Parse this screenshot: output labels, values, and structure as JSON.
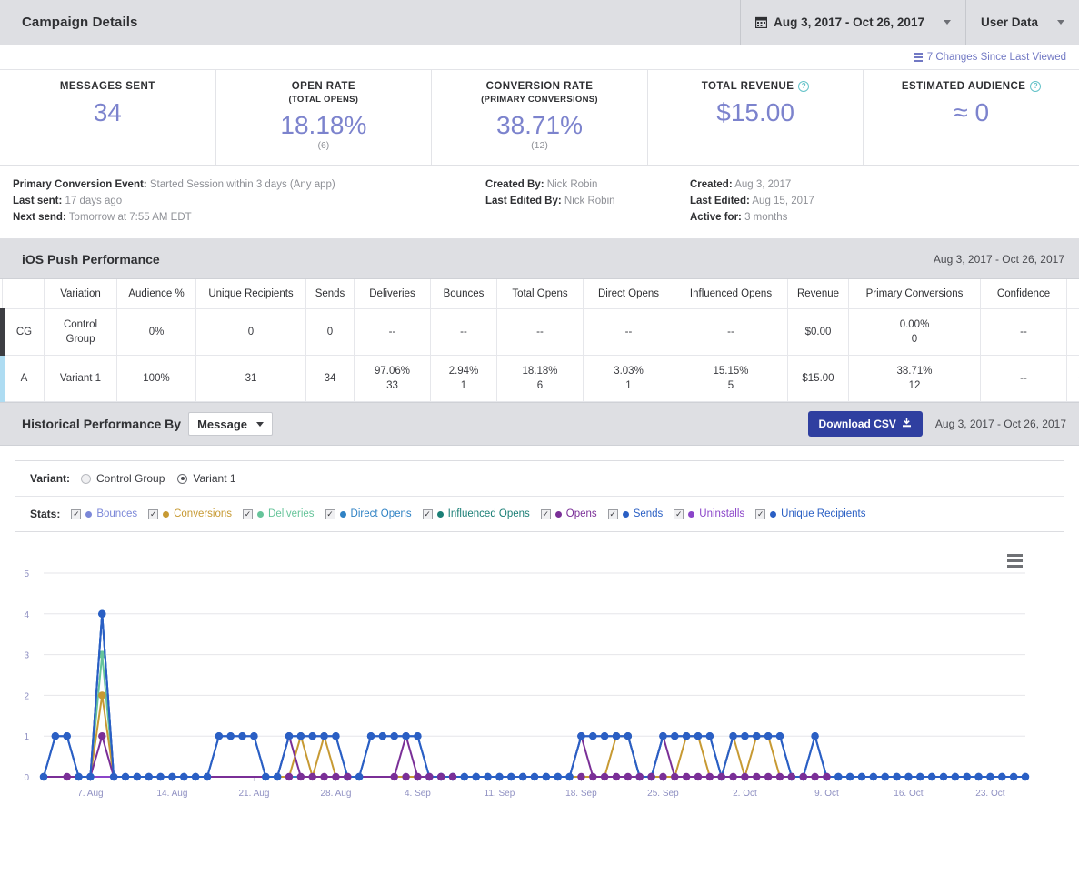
{
  "header": {
    "title": "Campaign Details",
    "date_range": "Aug 3, 2017 - Oct 26, 2017",
    "date_icon": "calendar-icon",
    "user_data_label": "User Data",
    "caret_icon": "chevron-down-icon"
  },
  "changes": {
    "label": "7 Changes Since Last Viewed",
    "icon": "list-icon"
  },
  "kpis": [
    {
      "label": "MESSAGES SENT",
      "sub": "",
      "value": "34",
      "count": "",
      "info": false
    },
    {
      "label": "OPEN RATE",
      "sub": "(TOTAL OPENS)",
      "value": "18.18%",
      "count": "(6)",
      "info": false
    },
    {
      "label": "CONVERSION RATE",
      "sub": "(PRIMARY CONVERSIONS)",
      "value": "38.71%",
      "count": "(12)",
      "info": false
    },
    {
      "label": "TOTAL REVENUE",
      "sub": "",
      "value": "$15.00",
      "count": "",
      "info": true
    },
    {
      "label": "ESTIMATED AUDIENCE",
      "sub": "",
      "value": "≈ 0",
      "count": "",
      "info": true
    }
  ],
  "meta": {
    "left": [
      {
        "label": "Primary Conversion Event:",
        "value": "Started Session within 3 days (Any app)"
      },
      {
        "label": "Last sent:",
        "value": "17 days ago"
      },
      {
        "label": "Next send:",
        "value": "Tomorrow at 7:55 AM EDT"
      }
    ],
    "middle": [
      {
        "label": "Created By:",
        "value": "Nick Robin"
      },
      {
        "label": "Last Edited By:",
        "value": "Nick Robin"
      }
    ],
    "right": [
      {
        "label": "Created:",
        "value": "Aug 3, 2017"
      },
      {
        "label": "Last Edited:",
        "value": "Aug 15, 2017"
      },
      {
        "label": "Active for:",
        "value": "3 months"
      }
    ]
  },
  "performance": {
    "title": "iOS Push Performance",
    "date_range": "Aug 3, 2017 - Oct 26, 2017",
    "columns": [
      "",
      "Variation",
      "Audience %",
      "Unique Recipients",
      "Sends",
      "Deliveries",
      "Bounces",
      "Total Opens",
      "Direct Opens",
      "Influenced Opens",
      "Revenue",
      "Primary Conversions",
      "Confidence",
      ""
    ],
    "rows": [
      {
        "tag": "CG",
        "variation": "Control Group",
        "audience": "0%",
        "unique_recipients": "0",
        "sends": "0",
        "deliveries": "--",
        "deliveries_n": "",
        "bounces": "--",
        "bounces_n": "",
        "total_opens": "--",
        "total_opens_n": "",
        "direct_opens": "--",
        "direct_opens_n": "",
        "influenced_opens": "--",
        "influenced_opens_n": "",
        "revenue": "$0.00",
        "primary_conversions": "0.00%",
        "primary_conversions_n": "0",
        "confidence": "--",
        "eye": ""
      },
      {
        "tag": "A",
        "variation": "Variant 1",
        "audience": "100%",
        "unique_recipients": "31",
        "sends": "34",
        "deliveries": "97.06%",
        "deliveries_n": "33",
        "bounces": "2.94%",
        "bounces_n": "1",
        "total_opens": "18.18%",
        "total_opens_n": "6",
        "direct_opens": "3.03%",
        "direct_opens_n": "1",
        "influenced_opens": "15.15%",
        "influenced_opens_n": "5",
        "revenue": "$15.00",
        "primary_conversions": "38.71%",
        "primary_conversions_n": "12",
        "confidence": "--",
        "eye": "◉"
      }
    ]
  },
  "historical": {
    "title": "Historical Performance By",
    "select_value": "Message",
    "download_label": "Download CSV",
    "download_icon": "download-icon",
    "date_range": "Aug 3, 2017 - Oct 26, 2017"
  },
  "filters": {
    "variant_label": "Variant:",
    "variants": [
      {
        "label": "Control Group",
        "selected": false
      },
      {
        "label": "Variant 1",
        "selected": true
      }
    ],
    "stats_label": "Stats:",
    "stats": [
      {
        "label": "Bounces",
        "color": "#7b87d8",
        "checked": true
      },
      {
        "label": "Conversions",
        "color": "#c79a33",
        "checked": true
      },
      {
        "label": "Deliveries",
        "color": "#66c49a",
        "checked": true
      },
      {
        "label": "Direct Opens",
        "color": "#2f82c4",
        "checked": true
      },
      {
        "label": "Influenced Opens",
        "color": "#1b7f76",
        "checked": true
      },
      {
        "label": "Opens",
        "color": "#7a2f97",
        "checked": true
      },
      {
        "label": "Sends",
        "color": "#2a5fc4",
        "checked": true
      },
      {
        "label": "Uninstalls",
        "color": "#8b45c9",
        "checked": true
      },
      {
        "label": "Unique Recipients",
        "color": "#2a5fc4",
        "checked": true
      }
    ]
  },
  "chart_data": {
    "type": "line",
    "title": "",
    "xlabel": "",
    "ylabel": "",
    "menu_icon": "hamburger-menu-icon",
    "ylim": [
      0,
      5
    ],
    "yticks": [
      0,
      1,
      2,
      3,
      4,
      5
    ],
    "grid": true,
    "legend": "above-chart",
    "xtick_labels": [
      "7. Aug",
      "14. Aug",
      "21. Aug",
      "28. Aug",
      "4. Sep",
      "11. Sep",
      "18. Sep",
      "25. Sep",
      "2. Oct",
      "9. Oct",
      "16. Oct",
      "23. Oct"
    ],
    "xtick_indices": [
      4,
      11,
      18,
      25,
      32,
      39,
      46,
      53,
      60,
      67,
      74,
      81
    ],
    "x_start": "3. Aug",
    "x_end": "26. Oct",
    "n_points": 85,
    "series": [
      {
        "name": "Sends",
        "color": "#2a5fc4",
        "values": [
          0,
          1,
          1,
          0,
          0,
          4,
          0,
          0,
          0,
          0,
          0,
          0,
          0,
          0,
          0,
          1,
          1,
          1,
          1,
          0,
          0,
          1,
          1,
          1,
          1,
          1,
          0,
          0,
          1,
          1,
          1,
          1,
          1,
          0,
          0,
          0,
          0,
          0,
          0,
          0,
          0,
          0,
          0,
          0,
          0,
          0,
          1,
          1,
          1,
          1,
          1,
          0,
          0,
          1,
          1,
          1,
          1,
          1,
          0,
          1,
          1,
          1,
          1,
          1,
          0,
          0,
          1,
          0,
          0,
          0,
          0,
          0,
          0,
          0,
          0,
          0,
          0,
          0,
          0,
          0,
          0,
          0,
          0,
          0,
          0
        ]
      },
      {
        "name": "Unique Recipients",
        "color": "#2a5fc4",
        "values": [
          0,
          1,
          1,
          0,
          0,
          4,
          0,
          0,
          0,
          0,
          0,
          0,
          0,
          0,
          0,
          1,
          1,
          1,
          1,
          0,
          0,
          1,
          1,
          1,
          1,
          1,
          0,
          0,
          1,
          1,
          1,
          1,
          1,
          0,
          0,
          0,
          0,
          0,
          0,
          0,
          0,
          0,
          0,
          0,
          0,
          0,
          1,
          1,
          1,
          1,
          1,
          0,
          0,
          1,
          1,
          1,
          1,
          1,
          0,
          1,
          1,
          1,
          1,
          1,
          0,
          0,
          1,
          0,
          0,
          0,
          0,
          0,
          0,
          0,
          0,
          0,
          0,
          0,
          0,
          0,
          0,
          0,
          0,
          0,
          0
        ]
      },
      {
        "name": "Direct Opens",
        "color": "#2f82c4",
        "values": [
          0,
          0,
          0,
          0,
          0,
          4,
          0,
          0,
          0,
          0,
          0,
          0,
          0,
          0,
          0,
          0,
          0,
          0,
          0,
          0,
          0,
          0,
          0,
          0,
          0,
          0,
          0,
          0,
          0,
          0,
          0,
          0,
          0,
          0,
          0,
          0,
          0,
          0,
          0,
          0,
          0,
          0,
          0,
          0,
          0,
          0,
          0,
          0,
          0,
          0,
          0,
          0,
          0,
          0,
          0,
          0,
          0,
          0,
          0,
          0,
          0,
          0,
          0,
          0,
          0,
          0,
          0,
          0,
          0,
          0,
          0,
          0,
          0,
          0,
          0,
          0,
          0,
          0,
          0,
          0,
          0,
          0,
          0,
          0,
          0
        ]
      },
      {
        "name": "Deliveries",
        "color": "#66c49a",
        "values": [
          0,
          0,
          0,
          0,
          0,
          3,
          0,
          0,
          0,
          0,
          0,
          0,
          0,
          0,
          0,
          0,
          0,
          0,
          0,
          0,
          0,
          0,
          0,
          0,
          0,
          0,
          0,
          0,
          0,
          0,
          0,
          0,
          0,
          0,
          0,
          0,
          0,
          0,
          0,
          0,
          0,
          0,
          0,
          0,
          0,
          0,
          0,
          0,
          0,
          0,
          0,
          0,
          0,
          0,
          0,
          0,
          0,
          0,
          0,
          0,
          0,
          0,
          0,
          0,
          0,
          0,
          0,
          0,
          0,
          0,
          0,
          0,
          0,
          0,
          0,
          0,
          0,
          0,
          0,
          0,
          0,
          0,
          0,
          0,
          0
        ]
      },
      {
        "name": "Conversions",
        "color": "#c79a33",
        "values": [
          0,
          0,
          0,
          0,
          0,
          2,
          0,
          0,
          0,
          0,
          0,
          0,
          0,
          0,
          0,
          0,
          0,
          0,
          0,
          0,
          0,
          0,
          1,
          0,
          1,
          0,
          0,
          0,
          0,
          0,
          0,
          0,
          0,
          0,
          0,
          0,
          0,
          0,
          0,
          0,
          0,
          0,
          0,
          0,
          0,
          0,
          0,
          0,
          0,
          1,
          1,
          0,
          0,
          0,
          0,
          1,
          1,
          0,
          0,
          1,
          0,
          1,
          1,
          0,
          0,
          0,
          0,
          0,
          0,
          0,
          0,
          0,
          0,
          0,
          0,
          0,
          0,
          0,
          0,
          0,
          0,
          0,
          0,
          0,
          0
        ]
      },
      {
        "name": "Opens",
        "color": "#7a2f97",
        "values": [
          0,
          0,
          0,
          0,
          0,
          1,
          0,
          0,
          0,
          0,
          0,
          0,
          0,
          0,
          0,
          0,
          0,
          0,
          0,
          0,
          0,
          1,
          0,
          0,
          0,
          0,
          0,
          0,
          0,
          0,
          0,
          1,
          0,
          0,
          0,
          0,
          0,
          0,
          0,
          0,
          0,
          0,
          0,
          0,
          0,
          0,
          1,
          0,
          0,
          0,
          0,
          0,
          0,
          1,
          0,
          0,
          0,
          0,
          0,
          0,
          0,
          0,
          0,
          0,
          0,
          0,
          0,
          0,
          0,
          0,
          0,
          0,
          0,
          0,
          0,
          0,
          0,
          0,
          0,
          0,
          0,
          0,
          0,
          0,
          0
        ]
      },
      {
        "name": "Influenced Opens",
        "color": "#1b7f76",
        "values": [
          0,
          0,
          0,
          0,
          0,
          0,
          0,
          0,
          0,
          0,
          0,
          0,
          0,
          0,
          0,
          0,
          0,
          0,
          0,
          0,
          0,
          0,
          0,
          0,
          0,
          0,
          0,
          0,
          0,
          0,
          0,
          0,
          0,
          0,
          0,
          0,
          0,
          0,
          0,
          0,
          0,
          0,
          0,
          0,
          0,
          0,
          0,
          0,
          0,
          0,
          0,
          0,
          0,
          0,
          0,
          0,
          0,
          0,
          0,
          0,
          0,
          0,
          0,
          0,
          0,
          0,
          0,
          0,
          0,
          0,
          0,
          0,
          0,
          0,
          0,
          0,
          0,
          0,
          0,
          0,
          0,
          0,
          0,
          0,
          0
        ]
      },
      {
        "name": "Bounces",
        "color": "#7b87d8",
        "values": [
          0,
          0,
          0,
          0,
          0,
          0,
          0,
          0,
          0,
          0,
          0,
          0,
          0,
          0,
          0,
          0,
          0,
          0,
          0,
          0,
          0,
          0,
          0,
          0,
          0,
          0,
          0,
          0,
          0,
          0,
          0,
          0,
          0,
          0,
          0,
          0,
          0,
          0,
          0,
          0,
          0,
          0,
          0,
          0,
          0,
          0,
          0,
          0,
          0,
          0,
          0,
          0,
          0,
          0,
          0,
          0,
          0,
          0,
          0,
          0,
          0,
          0,
          0,
          0,
          0,
          0,
          0,
          0,
          0,
          0,
          0,
          0,
          0,
          0,
          0,
          0,
          0,
          0,
          0,
          0,
          0,
          0,
          0,
          0,
          0
        ]
      },
      {
        "name": "Uninstalls",
        "color": "#8b45c9",
        "values": [
          0,
          0,
          0,
          0,
          0,
          0,
          0,
          0,
          0,
          0,
          0,
          0,
          0,
          0,
          0,
          0,
          0,
          0,
          0,
          0,
          0,
          0,
          0,
          0,
          0,
          0,
          0,
          0,
          0,
          0,
          0,
          0,
          0,
          0,
          0,
          0,
          0,
          0,
          0,
          0,
          0,
          0,
          0,
          0,
          0,
          0,
          0,
          0,
          0,
          0,
          0,
          0,
          0,
          0,
          0,
          0,
          0,
          0,
          0,
          0,
          0,
          0,
          0,
          0,
          0,
          0,
          0,
          0,
          0,
          0,
          0,
          0,
          0,
          0,
          0,
          0,
          0,
          0,
          0,
          0,
          0,
          0,
          0,
          0,
          0
        ]
      }
    ],
    "zero_markers": {
      "note": "purple markers on zero baseline for Opens/Uninstalls",
      "color": "#7a2f97",
      "indices": [
        2,
        21,
        22,
        23,
        24,
        25,
        26,
        30,
        31,
        32,
        33,
        34,
        35,
        46,
        47,
        48,
        49,
        50,
        51,
        52,
        53,
        54,
        55,
        56,
        57,
        58,
        59,
        60,
        61,
        62,
        63,
        64,
        65,
        66,
        67
      ]
    }
  }
}
